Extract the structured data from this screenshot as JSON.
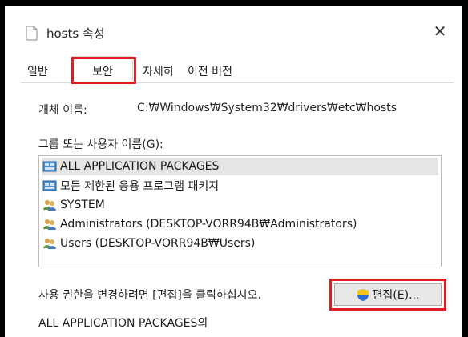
{
  "window": {
    "title": "hosts 속성",
    "close_glyph": "✕"
  },
  "tabs": [
    {
      "label": "일반"
    },
    {
      "label": "보안"
    },
    {
      "label": "자세히"
    },
    {
      "label": "이전 버전"
    }
  ],
  "active_tab": "보안",
  "object": {
    "label": "개체 이름:",
    "value": "C:₩Windows₩System32₩drivers₩etc₩hosts"
  },
  "groups": {
    "label": "그룹 또는 사용자 이름(G):",
    "items": [
      {
        "name": "ALL APPLICATION PACKAGES",
        "icon": "app-packages-icon"
      },
      {
        "name": "모든 제한된 응용 프로그램 패키지",
        "icon": "app-packages-icon"
      },
      {
        "name": "SYSTEM",
        "icon": "user-group-icon"
      },
      {
        "name": "Administrators (DESKTOP-VORR94B₩Administrators)",
        "icon": "user-group-icon"
      },
      {
        "name": "Users (DESKTOP-VORR94B₩Users)",
        "icon": "user-group-icon"
      }
    ],
    "selected_index": 0
  },
  "hint": "사용 권한을 변경하려면 [편집]을 클릭하십시오.",
  "edit_button": {
    "label": "편집(E)...",
    "icon": "uac-shield-icon"
  },
  "permissions_label": "ALL APPLICATION PACKAGES의",
  "colors": {
    "highlight": "#e01b22",
    "selected_row": "#e5e5e5"
  }
}
